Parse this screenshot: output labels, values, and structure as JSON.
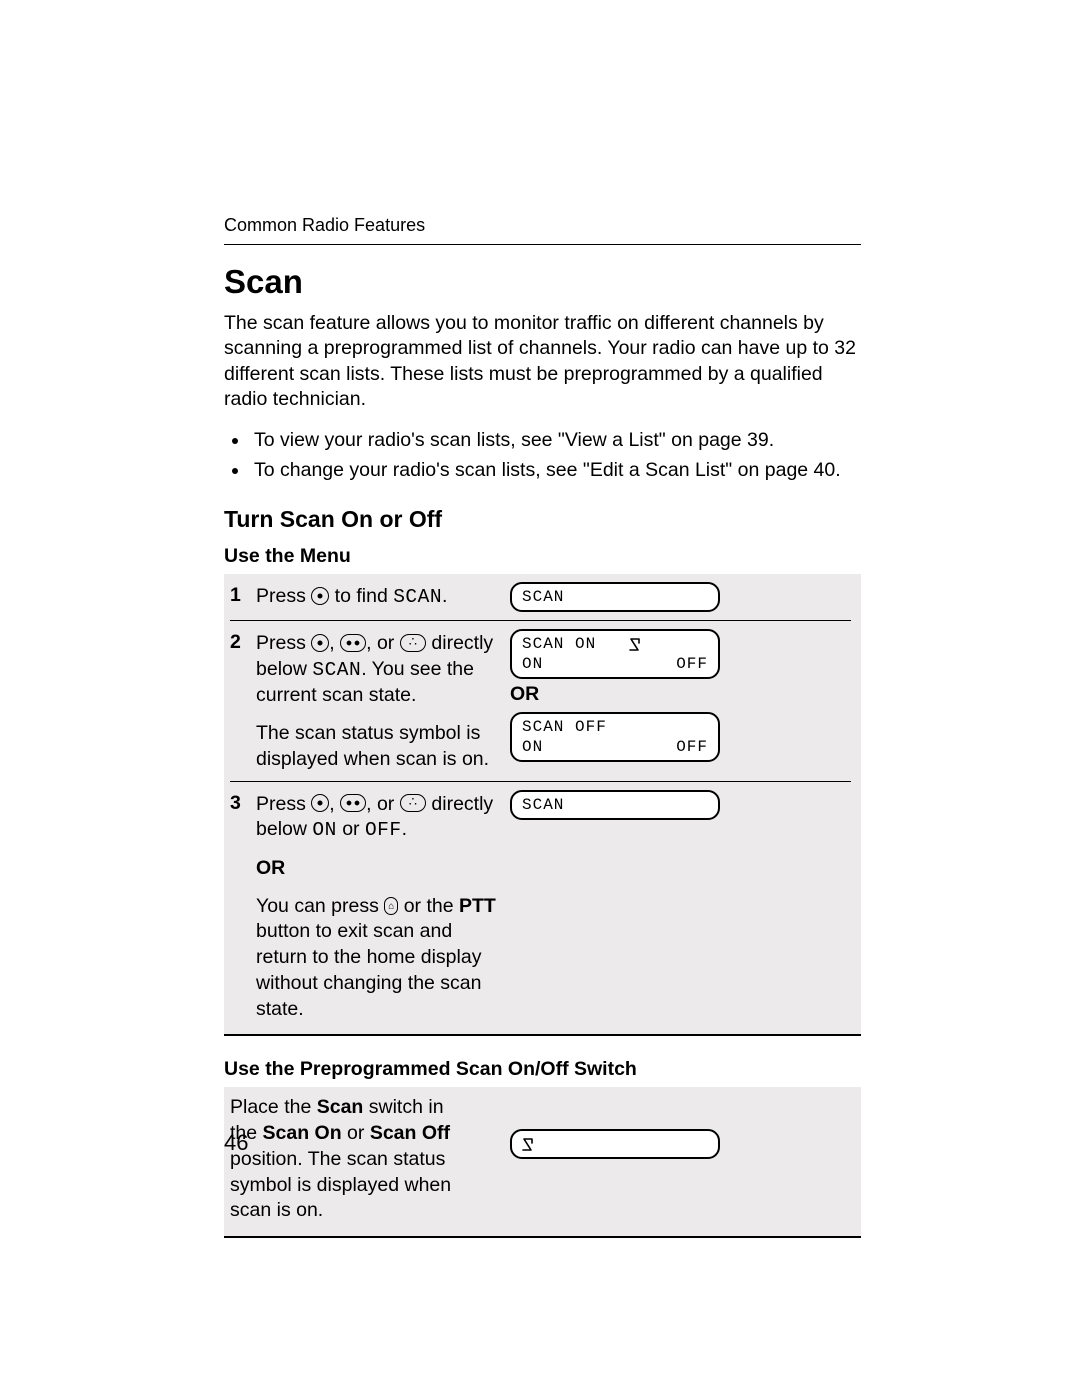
{
  "header": "Common Radio Features",
  "title": "Scan",
  "intro": "The scan feature allows you to monitor traffic on different channels by scanning a preprogrammed list of channels. Your radio can have up to 32 different scan lists. These lists must be preprogrammed by a qualified radio technician.",
  "bullets": [
    "To view your radio's scan lists, see \"View a List\" on page 39.",
    "To change your radio's scan lists, see \"Edit a Scan List\" on page 40."
  ],
  "section1_title": "Turn Scan On or Off",
  "use_menu_title": "Use the Menu",
  "steps": {
    "s1": {
      "num": "1",
      "press": "Press ",
      "tofind": " to find ",
      "scan": "SCAN",
      "dot": "."
    },
    "s2": {
      "num": "2",
      "press": "Press ",
      "comma1": ", ",
      "comma2": ", or ",
      "line1b": "directly below ",
      "scan": "SCAN",
      "line1c": ". You see the current scan state.",
      "line2": "The scan status symbol is displayed when scan is on."
    },
    "s3": {
      "num": "3",
      "press": "Press ",
      "comma1": ", ",
      "comma2": ", or ",
      "line1b": "directly below ",
      "on": "ON",
      "or_word": " or ",
      "off": "OFF",
      "dot": ".",
      "or_label": "OR",
      "line2a": "You can press ",
      "line2b": " or the ",
      "ptt": "PTT",
      "line2c": " button to exit scan and return to the home display without changing the scan state."
    }
  },
  "screens": {
    "scr1": "SCAN",
    "scr2": {
      "top": "SCAN ON",
      "bl": "ON",
      "br": "OFF"
    },
    "or_label": "OR",
    "scr3": {
      "top": "SCAN OFF",
      "bl": "ON",
      "br": "OFF"
    },
    "scr4": "SCAN"
  },
  "use_switch_title": "Use the Preprogrammed Scan On/Off Switch",
  "switch_text": {
    "a": "Place the ",
    "scan": "Scan",
    "b": " switch in the ",
    "on": "Scan On",
    "or": " or ",
    "off": "Scan Off",
    "c": " position. The scan status symbol is displayed when scan is on."
  },
  "page_number": "46"
}
